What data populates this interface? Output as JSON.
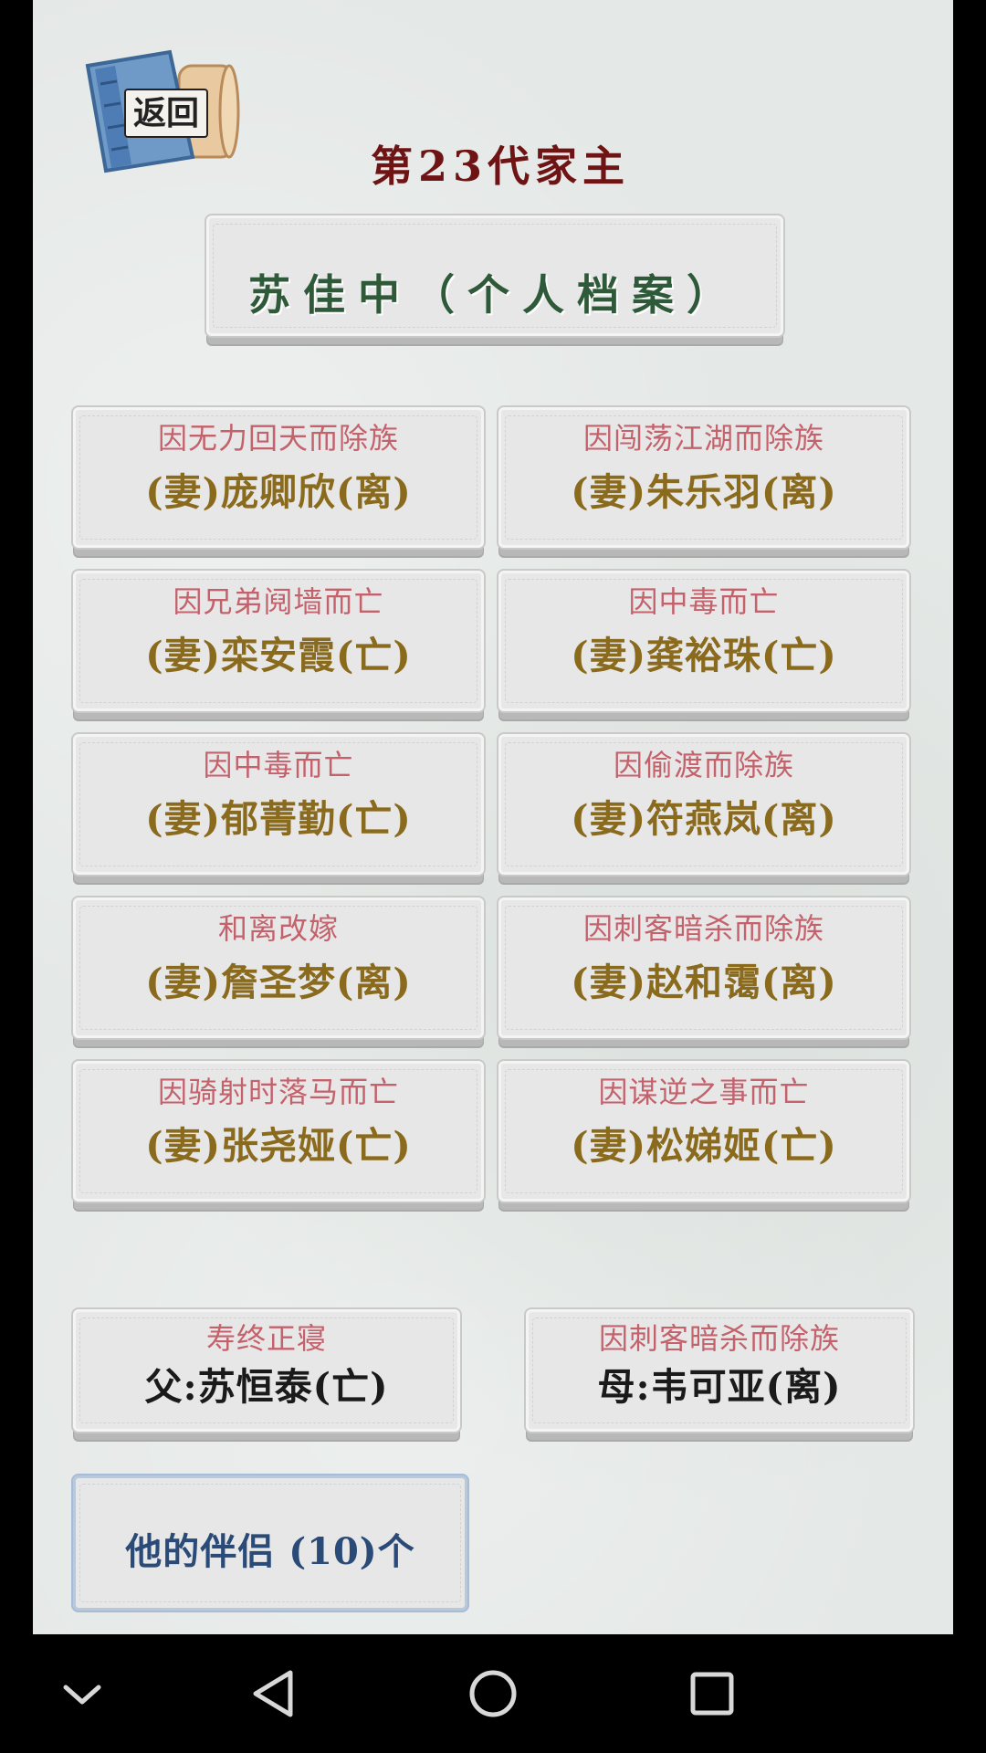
{
  "header": {
    "back_label": "返回",
    "generation_title": "第23代家主",
    "profile_title": "苏佳中（个人档案）"
  },
  "wives": [
    {
      "reason": "因无力回天而除族",
      "name": "(妻)庞卿欣(离)"
    },
    {
      "reason": "因闯荡江湖而除族",
      "name": "(妻)朱乐羽(离)"
    },
    {
      "reason": "因兄弟阋墙而亡",
      "name": "(妻)栾安霞(亡)"
    },
    {
      "reason": "因中毒而亡",
      "name": "(妻)龚裕珠(亡)"
    },
    {
      "reason": "因中毒而亡",
      "name": "(妻)郁菁勤(亡)"
    },
    {
      "reason": "因偷渡而除族",
      "name": "(妻)符燕岚(离)"
    },
    {
      "reason": "和离改嫁",
      "name": "(妻)詹圣梦(离)"
    },
    {
      "reason": "因刺客暗杀而除族",
      "name": "(妻)赵和霭(离)"
    },
    {
      "reason": "因骑射时落马而亡",
      "name": "(妻)张尧娅(亡)"
    },
    {
      "reason": "因谋逆之事而亡",
      "name": "(妻)松娣姬(亡)"
    }
  ],
  "parents": {
    "father": {
      "reason": "寿终正寝",
      "name": "父:苏恒泰(亡)"
    },
    "mother": {
      "reason": "因刺客暗杀而除族",
      "name": "母:韦可亚(离)"
    }
  },
  "partners_button": {
    "label": "他的伴侣 (10)个"
  },
  "navbar": {
    "icons": [
      "chevron-down-icon",
      "back-triangle-icon",
      "home-circle-icon",
      "recents-square-icon"
    ]
  }
}
